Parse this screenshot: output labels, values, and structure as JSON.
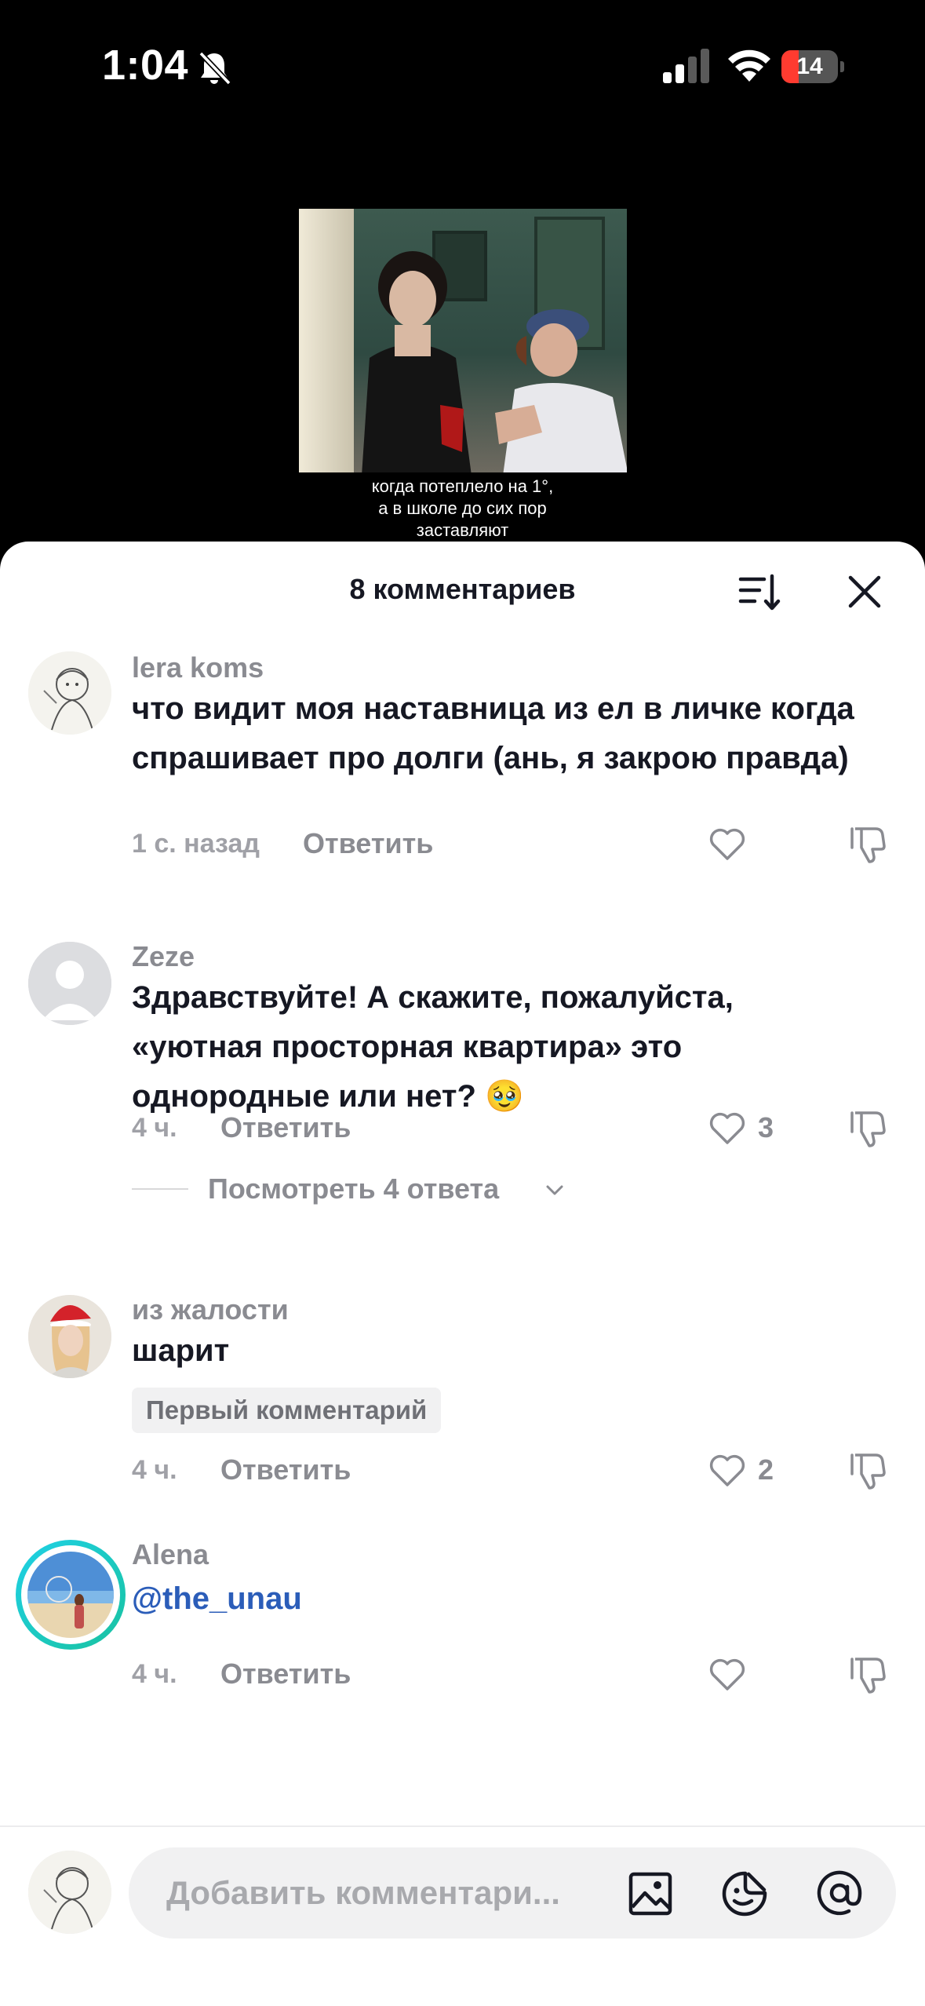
{
  "status_bar": {
    "time": "1:04",
    "battery": "14",
    "battery_level": 0.14,
    "icons": [
      "bell-slash-icon",
      "signal-icon",
      "wifi-icon",
      "battery-icon"
    ]
  },
  "video": {
    "subtitle_lines": [
      "когда потеплело на 1°,",
      "а в школе до сих пор",
      "заставляют"
    ]
  },
  "sheet": {
    "title": "8 комментариев",
    "sort_icon": "sort-icon",
    "close_icon": "close-icon"
  },
  "comments": [
    {
      "username": "lera koms",
      "text": "что видит моя наставница из ел в личке когда спрашивает про долги (ань, я закрою правда)",
      "time": "1 с. назад",
      "reply": "Ответить",
      "likes": ""
    },
    {
      "username": "Zeze",
      "text": "Здравствуйте! А скажите, пожалуйста, «уютная просторная квартира» это однородные или нет? 🥹",
      "time": "4 ч.",
      "reply": "Ответить",
      "likes": "3",
      "view_replies": "Посмотреть 4 ответа"
    },
    {
      "username": "из жалости",
      "text": "шарит",
      "badge": "Первый комментарий",
      "time": "4 ч.",
      "reply": "Ответить",
      "likes": "2"
    },
    {
      "username": "Alena",
      "text": "@the_unau",
      "time": "4 ч.",
      "reply": "Ответить",
      "likes": ""
    }
  ],
  "input": {
    "placeholder": "Добавить комментари...",
    "icons": [
      "image-icon",
      "emoji-icon",
      "at-sign-icon"
    ]
  },
  "colors": {
    "mention": "#2b5db9",
    "story_ring": "#1fd1e6",
    "battery_low": "#ff3b30"
  }
}
